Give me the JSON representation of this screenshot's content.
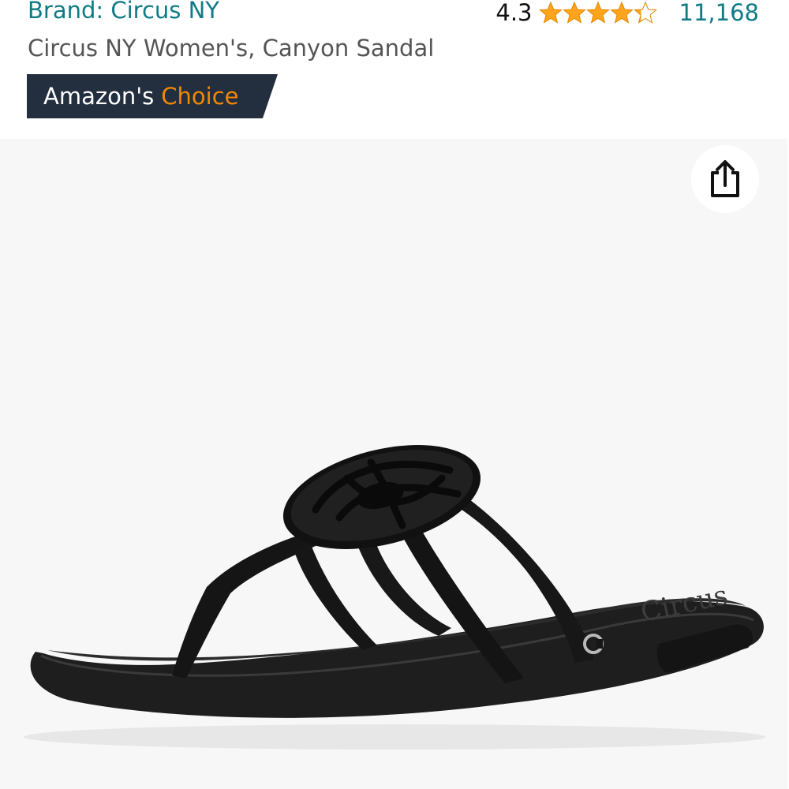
{
  "header": {
    "brand_link": "Brand: Circus NY",
    "rating_value": "4.3",
    "rating_stars": 4.3,
    "rating_count": "11,168",
    "product_title": "Circus NY Women's, Canyon Sandal"
  },
  "badge": {
    "prefix": "Amazon's",
    "highlight": "Choice"
  },
  "colors": {
    "link_teal": "#0f7b86",
    "badge_navy": "#232f3e",
    "badge_orange": "#f08804",
    "star_gold": "#ffa41c",
    "image_background": "#f7f7f7"
  },
  "icons": {
    "share": "share-icon",
    "star": "star-icon"
  }
}
